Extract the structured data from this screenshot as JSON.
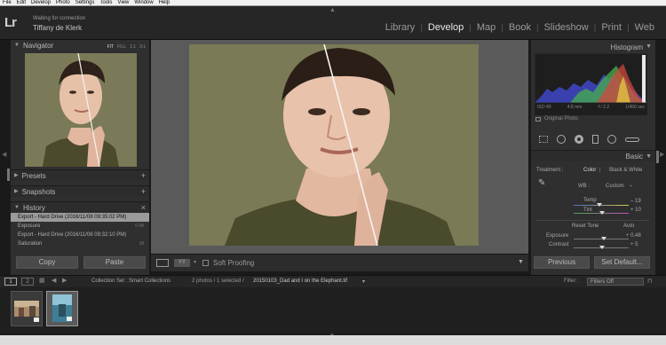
{
  "menu": [
    "File",
    "Edit",
    "Develop",
    "Photo",
    "Settings",
    "Tools",
    "View",
    "Window",
    "Help"
  ],
  "identity": {
    "status": "Waiting for connection",
    "name": "Tiffany de Klerk"
  },
  "modules": [
    "Library",
    "Develop",
    "Map",
    "Book",
    "Slideshow",
    "Print",
    "Web"
  ],
  "navigator": {
    "title": "Navigator",
    "zoom": [
      "FIT",
      "FILL",
      "1:1",
      "3:1"
    ]
  },
  "presets": {
    "title": "Presets"
  },
  "snapshots": {
    "title": "Snapshots"
  },
  "history": {
    "title": "History",
    "items": [
      {
        "label": "Export - Hard Drive (2016/11/08 09:35:02 PM)",
        "value": ""
      },
      {
        "label": "Exposure",
        "value": "0.48"
      },
      {
        "label": "Export - Hard Drive (2016/11/08 09:32:10 PM)",
        "value": ""
      },
      {
        "label": "Saturation",
        "value": "18"
      }
    ]
  },
  "left_buttons": {
    "copy": "Copy",
    "paste": "Paste"
  },
  "toolbar": {
    "soft_proofing": "Soft Proofing"
  },
  "histogram_panel": {
    "title": "Histogram",
    "iso": "ISO 40",
    "focal": "4.8 mm",
    "aperture": "f / 2.2",
    "shutter": "1/450 sec",
    "original": "Original Photo"
  },
  "basic": {
    "title": "Basic",
    "treatment_label": "Treatment :",
    "color": "Color",
    "bw": "Black & White",
    "wb_label": "WB :",
    "wb_value": "Custom",
    "temp_label": "Temp",
    "temp_value": "– 19",
    "tint_label": "Tint",
    "tint_value": "+ 10",
    "tone_label": "Reset Tone",
    "auto": "Auto",
    "exposure_label": "Exposure",
    "exposure_value": "+ 0.48",
    "contrast_label": "Contrast",
    "contrast_value": "+ 5"
  },
  "right_buttons": {
    "previous": "Previous",
    "set_default": "Set Default..."
  },
  "filmbar": {
    "page1": "1",
    "page2": "2",
    "source": "Collection Set : Smart Collections",
    "count": "2 photos / 1 selected /",
    "filename": "20150103_Dad and I on the Elephant.tif",
    "filter_label": "Filter :",
    "filter_value": "Filters Off"
  }
}
